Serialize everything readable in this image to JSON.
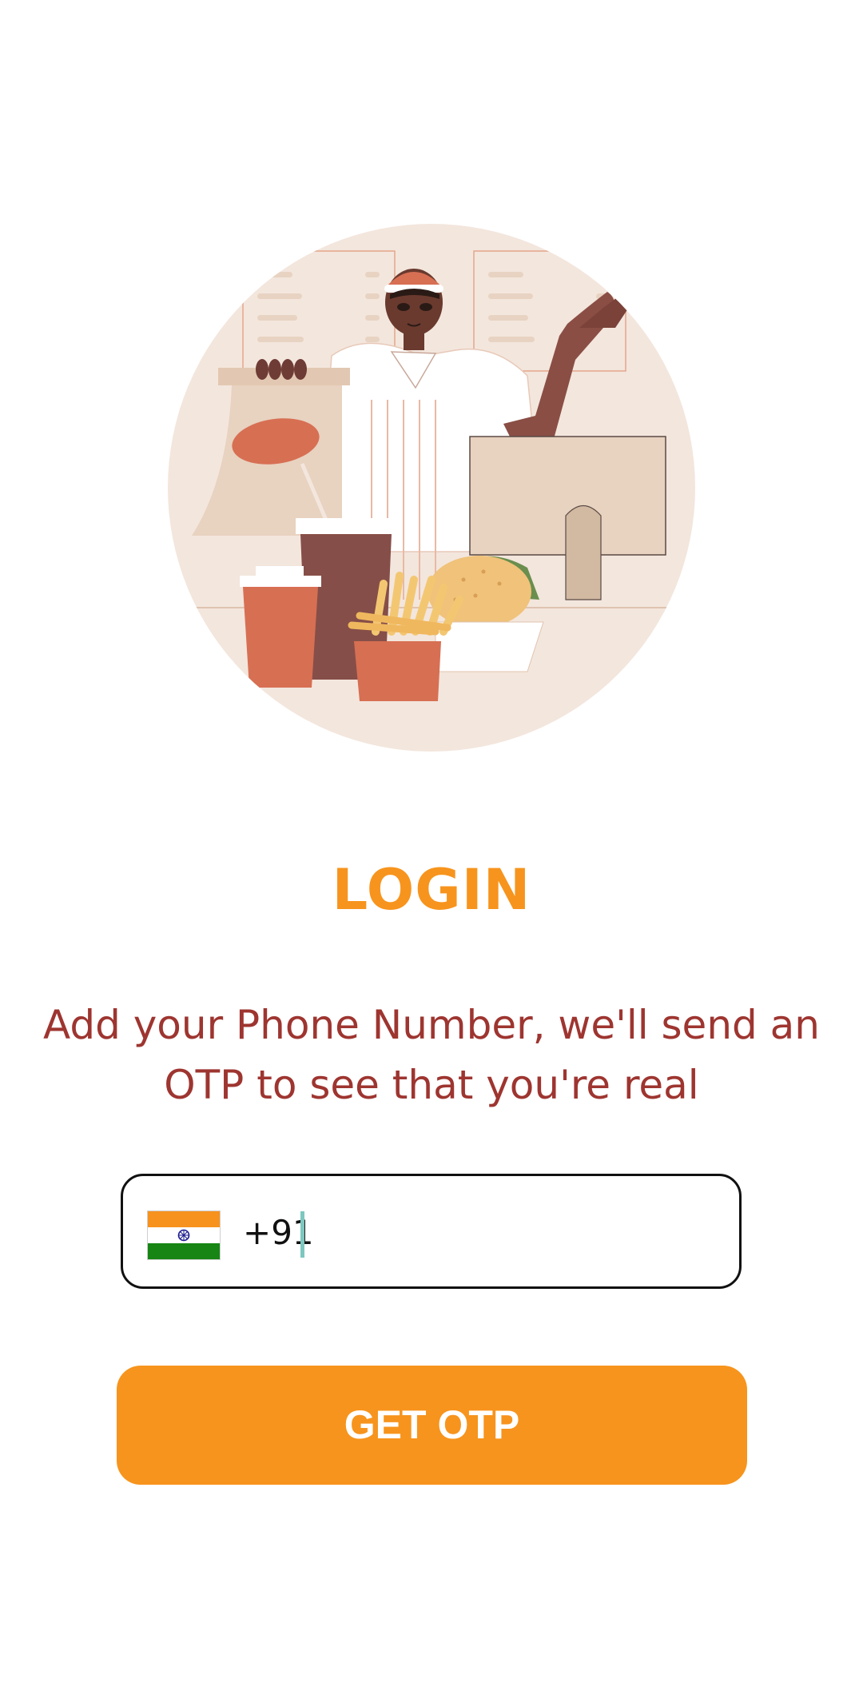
{
  "colors": {
    "accent": "#F7941D",
    "subtitle": "#9E3530",
    "caret": "#7CC7C0",
    "circle": "#F3E6DD",
    "flag_saffron": "#F7921E",
    "flag_green": "#168513",
    "flag_chakra": "#1B1B8F"
  },
  "illustration": {
    "name": "fast-food-vendor-illustration"
  },
  "login": {
    "title": "LOGIN",
    "subtitle": "Add your Phone Number, we'll send an OTP to see that you're real"
  },
  "phone": {
    "flag_icon": "india-flag-icon",
    "country_code": "+91",
    "value": ""
  },
  "button": {
    "label": "GET OTP"
  }
}
